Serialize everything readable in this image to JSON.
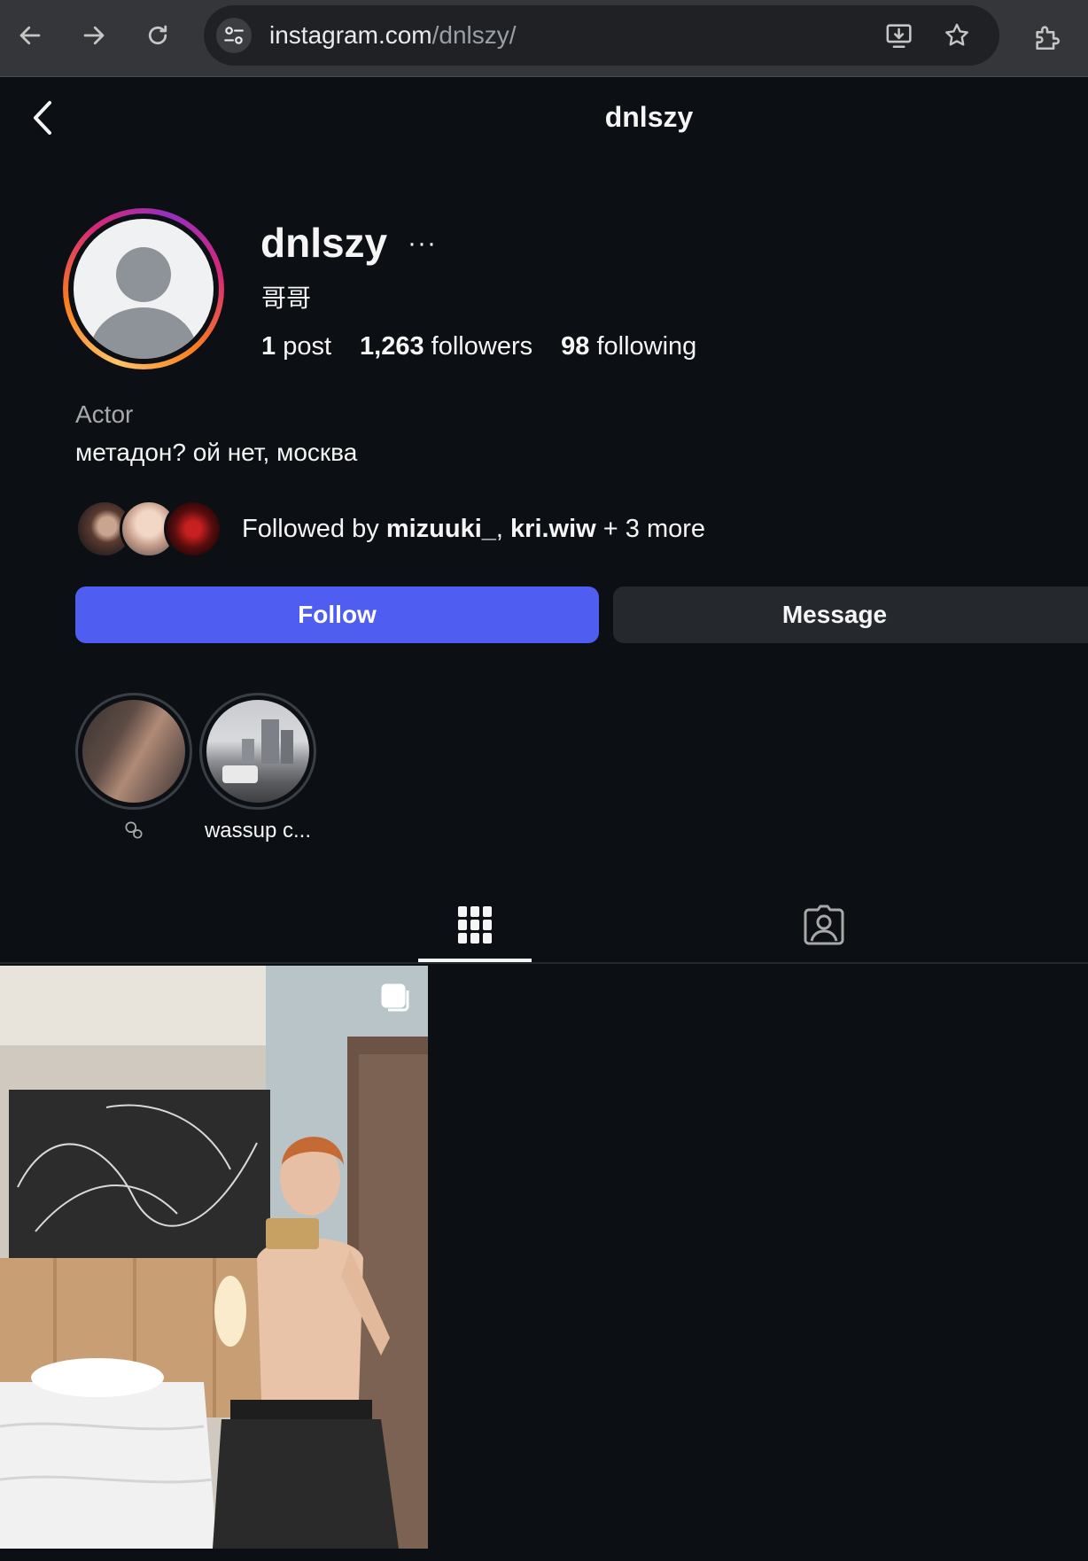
{
  "browser": {
    "url_host": "instagram.com",
    "url_path": "/dnlszy/"
  },
  "header": {
    "title": "dnlszy"
  },
  "profile": {
    "username": "dnlszy",
    "more": "···",
    "full_name": "哥哥",
    "stats": {
      "posts_count": "1",
      "posts_label": "post",
      "followers_count": "1,263",
      "followers_label": "followers",
      "following_count": "98",
      "following_label": "following"
    },
    "category": "Actor",
    "bio": "метадон? ой нет, москва",
    "followed_by": {
      "prefix": "Followed by ",
      "user1": "mizuuki_",
      "sep": ", ",
      "user2": "kri.wiw",
      "suffix": " + 3 more"
    }
  },
  "actions": {
    "follow_label": "Follow",
    "message_label": "Message"
  },
  "highlights": [
    {
      "label": ""
    },
    {
      "label": "wassup c..."
    }
  ],
  "tabs": [
    {
      "name": "posts",
      "icon": "grid-icon",
      "active": true
    },
    {
      "name": "tagged",
      "icon": "tagged-icon",
      "active": false
    }
  ],
  "colors": {
    "background": "#0c1014",
    "follow_button": "#4f5ef0",
    "message_button": "#25292e"
  }
}
